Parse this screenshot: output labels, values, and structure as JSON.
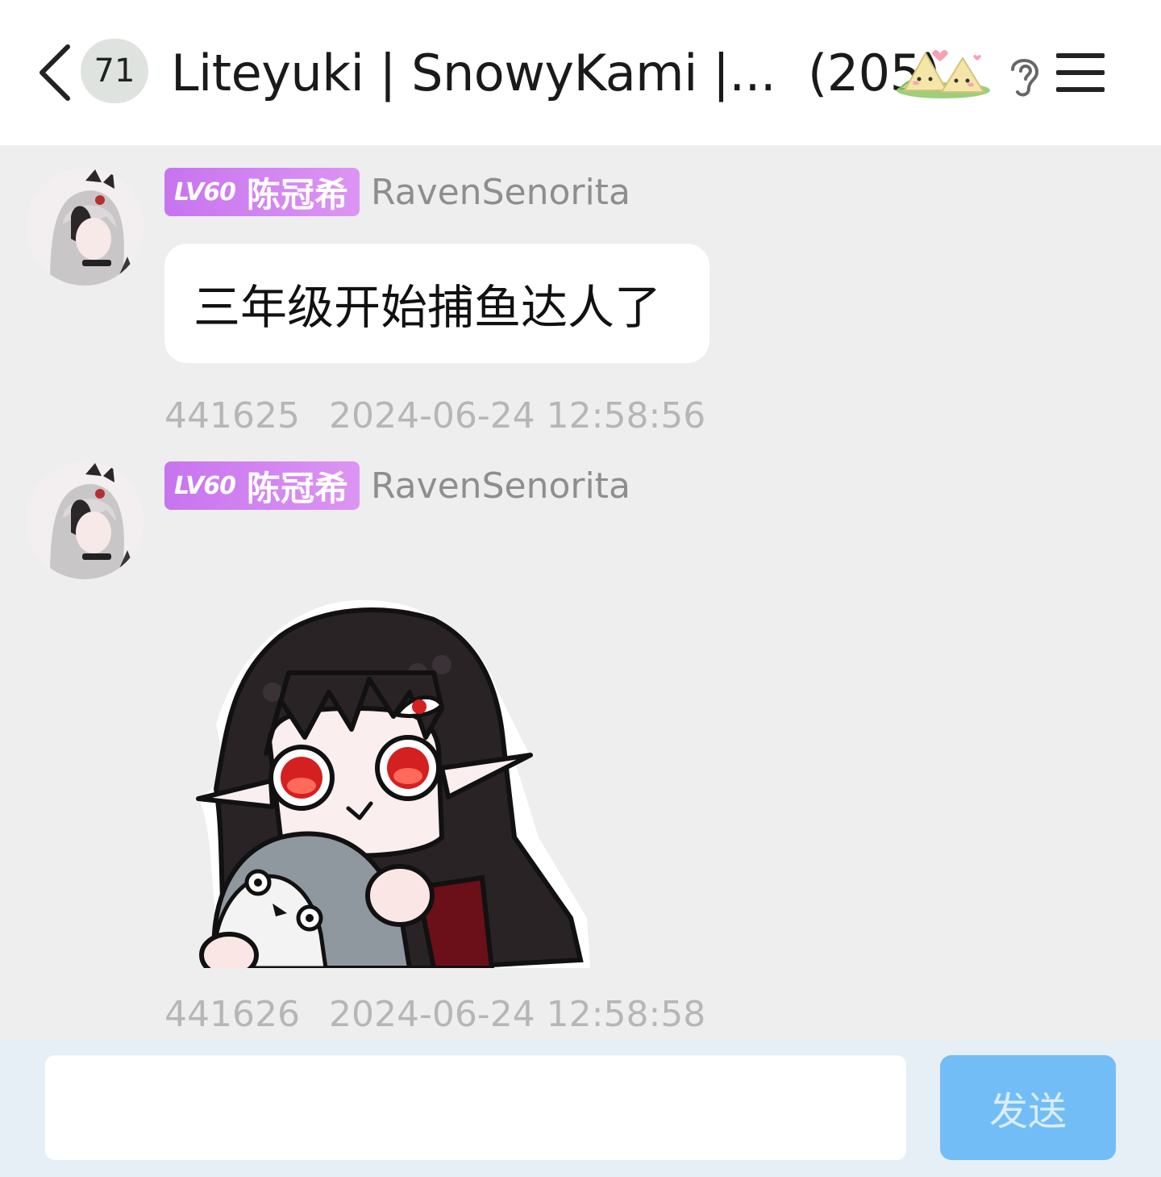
{
  "header": {
    "unread_count": "71",
    "group_name": "Liteyuki | SnowyKami |...",
    "member_count": "(205)"
  },
  "messages": [
    {
      "level": "LV60",
      "title": "陈冠希",
      "username": "RavenSenorita",
      "text": "三年级开始捕鱼达人了",
      "msg_id": "441625",
      "timestamp": "2024-06-24 12:58:56"
    },
    {
      "level": "LV60",
      "title": "陈冠希",
      "username": "RavenSenorita",
      "sticker": "anime-girl-holding-seal-sticker",
      "msg_id": "441626",
      "timestamp": "2024-06-24 12:58:58"
    }
  ],
  "composer": {
    "input_value": "",
    "send_label": "发送"
  },
  "colors": {
    "level_badge": "#c774ef",
    "send_button": "#73bdf6",
    "background": "#eeeeee"
  },
  "icons": [
    "back-chevron-icon",
    "rice-dumpling-emoji-icon",
    "ear-icon",
    "menu-icon"
  ]
}
